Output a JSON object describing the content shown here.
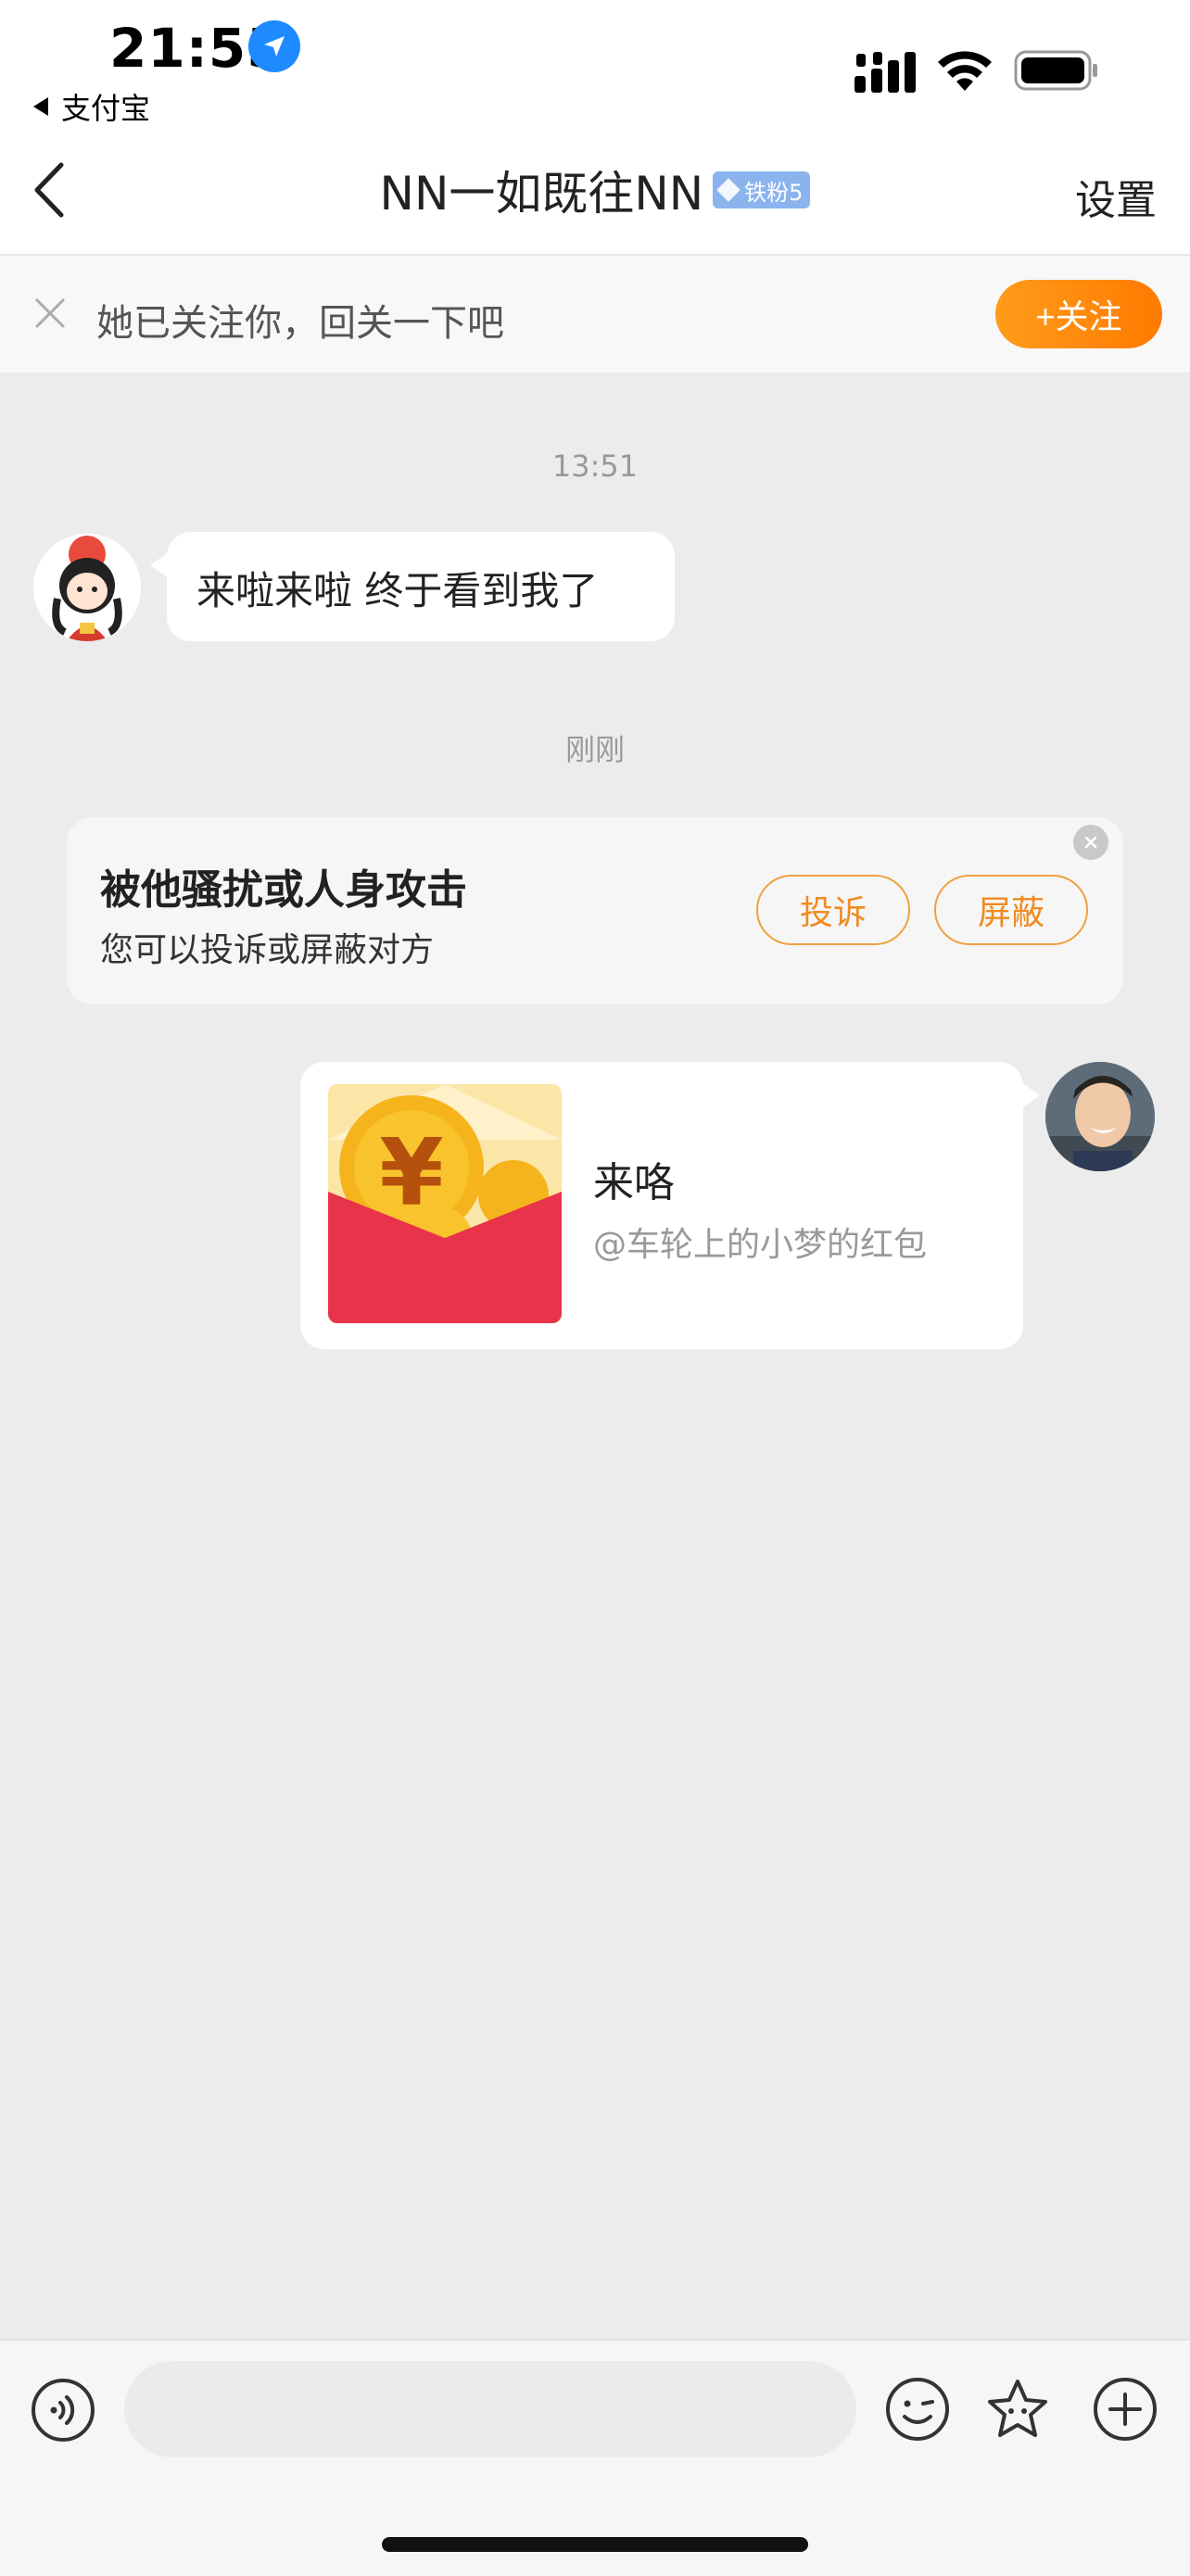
{
  "status_bar": {
    "time": "21:55",
    "back_app_label": "支付宝",
    "icons": [
      "location-arrow-icon",
      "cellular-signal-icon",
      "wifi-icon",
      "battery-icon"
    ]
  },
  "nav": {
    "title": "NN一如既往NN",
    "badge": "铁粉5",
    "settings_label": "设置",
    "icons": [
      "back-chevron-icon",
      "diamond-icon"
    ]
  },
  "follow_banner": {
    "text": "她已关注你，回关一下吧",
    "button_label": "+关注"
  },
  "chat": {
    "timestamp_1": "13:51",
    "message_1": "来啦来啦 终于看到我了",
    "timestamp_2": "刚刚",
    "warning": {
      "title": "被他骚扰或人身攻击",
      "subtitle": "您可以投诉或屏蔽对方",
      "report_label": "投诉",
      "block_label": "屏蔽"
    },
    "red_packet": {
      "title": "来咯",
      "subtitle": "@车轮上的小梦的红包"
    }
  },
  "input_bar": {
    "placeholder": "",
    "icons": [
      "voice-icon",
      "emoji-icon",
      "sticker-icon",
      "plus-icon"
    ]
  },
  "colors": {
    "accent_orange": "#ff8c0a",
    "badge_blue": "#8bb4ee",
    "background": "#ececec",
    "red_packet": "#e8344a"
  }
}
